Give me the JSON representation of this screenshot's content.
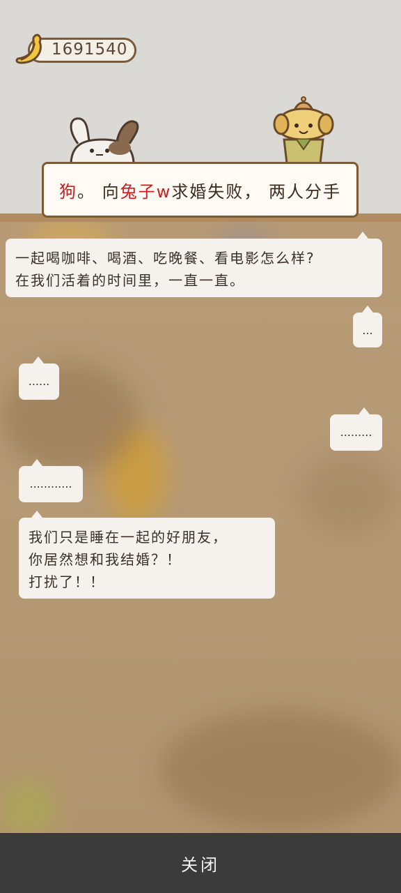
{
  "currency": {
    "icon": "banana-icon",
    "amount": "1691540"
  },
  "event_title": {
    "actor": "狗",
    "sep": "。 向 ",
    "partner": "兔子w",
    "result": "求婚失败， 两人分手"
  },
  "dialogue": [
    {
      "side": "left",
      "text": "一起喝咖啡、喝酒、吃晚餐、看电影怎么样?\n在我们活着的时间里，一直一直。"
    },
    {
      "side": "right",
      "text": "..."
    },
    {
      "side": "left",
      "text": "......"
    },
    {
      "side": "right",
      "text": "........."
    },
    {
      "side": "left",
      "text": "............"
    },
    {
      "side": "left",
      "text": "我们只是睡在一起的好朋友，\n你居然想和我结婚？！\n打扰了！！"
    }
  ],
  "close_button": {
    "label": "关闭"
  },
  "colors": {
    "accent_red": "#d11a1a",
    "banner_border": "#7c5a35",
    "close_bar": "#3b3b3b"
  }
}
